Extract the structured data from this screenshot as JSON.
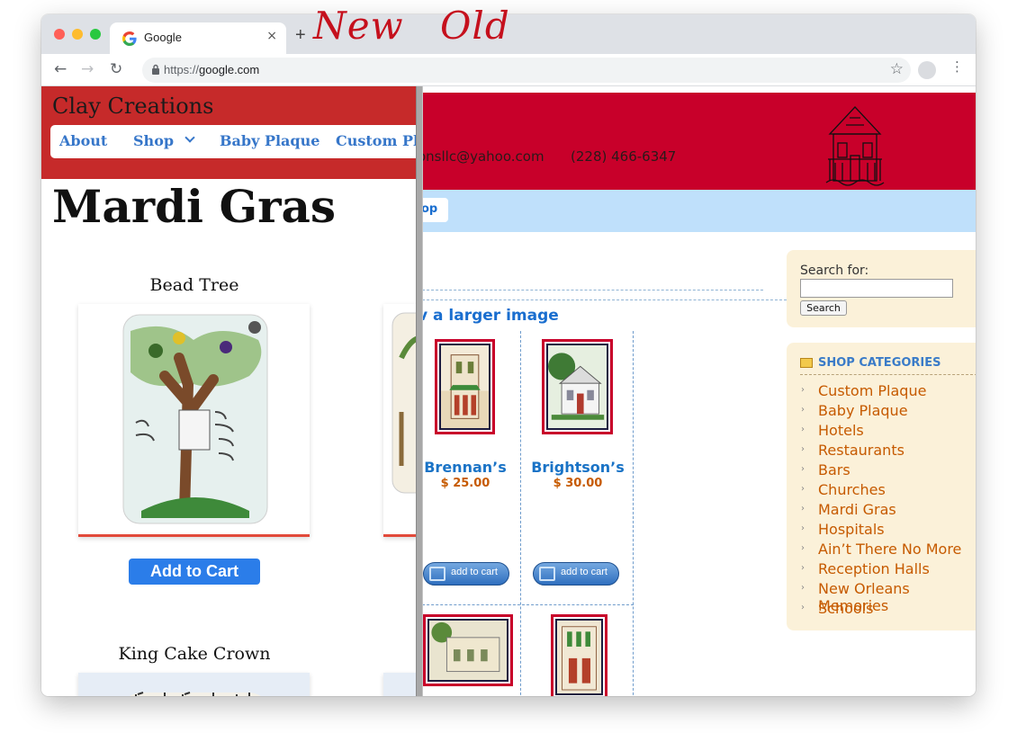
{
  "browser": {
    "tab_title": "Google",
    "tab_close": "×",
    "new_tab": "+",
    "url_scheme": "https://",
    "url_host": "google.com",
    "star": "☆",
    "kebab": "⋮"
  },
  "overlay": {
    "new_label": "New",
    "old_label": "Old"
  },
  "new_site": {
    "brand": "Clay Creations",
    "menu": [
      "About",
      "Shop",
      "Baby Plaque",
      "Custom Pla"
    ],
    "page_title": "Mardi Gras",
    "products": [
      {
        "title": "Bead Tree",
        "cta": "Add to Cart"
      },
      {
        "title": "King Cake Crown"
      }
    ]
  },
  "old_site": {
    "email": "onsllc@yahoo.com",
    "phone": "(228) 466-6347",
    "nav_tab": "op",
    "heading": "v a larger image",
    "products": [
      {
        "name": "Brennan’s",
        "price": "$ 25.00",
        "button": "add to cart"
      },
      {
        "name": "Brightson’s",
        "price": "$ 30.00",
        "button": "add to cart"
      }
    ],
    "search": {
      "label": "Search for:",
      "button": "Search"
    },
    "categories_title": "SHOP CATEGORIES",
    "categories": [
      "Custom Plaque",
      "Baby Plaque",
      "Hotels",
      "Restaurants",
      "Bars",
      "Churches",
      "Mardi Gras",
      "Hospitals",
      "Ain’t There No More",
      "Reception Halls",
      "New Orleans Memories",
      "Schools"
    ]
  },
  "colors": {
    "new_header": "#c62a2a",
    "old_header": "#c8002a",
    "link_blue": "#3676c9",
    "old_orange": "#c65a00"
  }
}
